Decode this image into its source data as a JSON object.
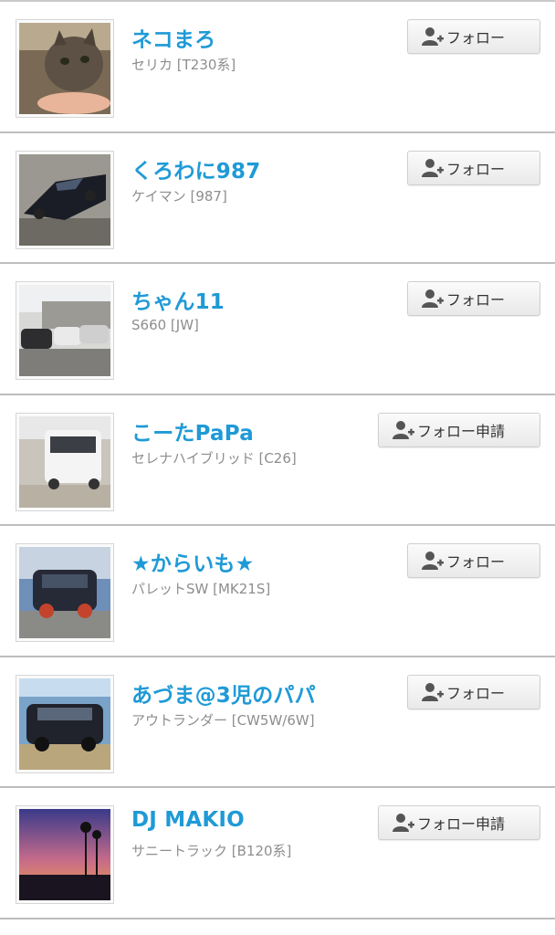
{
  "users": [
    {
      "name": "ネコまろ",
      "car": "セリカ [T230系]",
      "button": "フォロー",
      "image": "cat-photo"
    },
    {
      "name": "くろわに987",
      "car": "ケイマン [987]",
      "button": "フォロー",
      "image": "black-car-photo"
    },
    {
      "name": "ちゃん11",
      "car": "S660 [JW]",
      "button": "フォロー",
      "image": "parking-lot-photo"
    },
    {
      "name": "こーたPaPa",
      "car": "セレナハイブリッド [C26]",
      "button": "フォロー申請",
      "image": "white-minivan-photo"
    },
    {
      "name": "★からいも★",
      "car": "パレットSW [MK21S]",
      "button": "フォロー",
      "image": "dark-kei-car-photo"
    },
    {
      "name": "あづま@3児のパパ",
      "car": "アウトランダー [CW5W/6W]",
      "button": "フォロー",
      "image": "suv-photo"
    },
    {
      "name": "DJ MAKIO",
      "car": "サニートラック [B120系]",
      "button": "フォロー申請",
      "image": "sunset-palms-photo"
    }
  ],
  "icons": {
    "follow": "add-user-icon"
  },
  "colors": {
    "name": "#1f9ad6",
    "subtext": "#8e8e8e",
    "divider": "#bdbdbd"
  }
}
